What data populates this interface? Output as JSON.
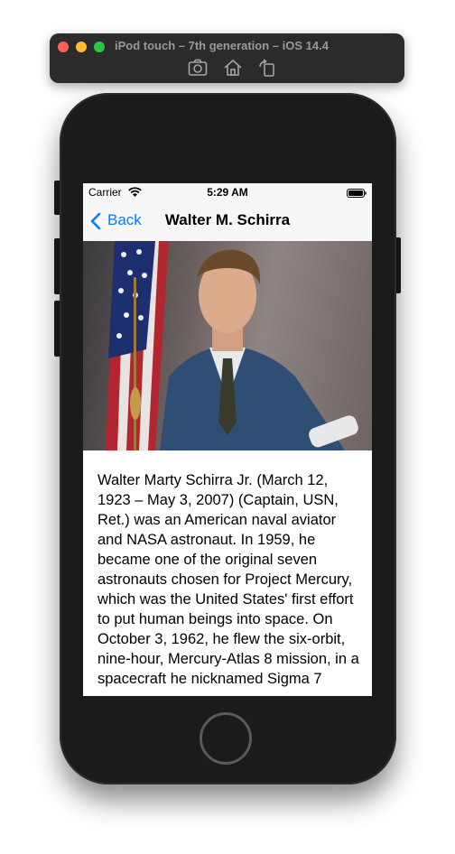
{
  "simulator": {
    "title": "iPod touch – 7th generation – iOS 14.4",
    "toolbar_icons": [
      "screenshot-icon",
      "home-icon",
      "rotate-icon"
    ]
  },
  "status_bar": {
    "carrier": "Carrier",
    "time": "5:29 AM"
  },
  "nav": {
    "back_label": "Back",
    "title": "Walter M. Schirra"
  },
  "detail": {
    "image_description_icon": "astronaut-portrait",
    "bio": "Walter Marty Schirra Jr. (March 12, 1923 – May 3, 2007) (Captain, USN, Ret.) was an American naval aviator and NASA astronaut. In 1959, he became one of the original seven astronauts chosen for Project Mercury, which was the United States' first effort to put human beings into space. On October 3, 1962, he flew the six-orbit, nine-hour, Mercury-Atlas 8 mission, in a spacecraft he nicknamed Sigma 7"
  },
  "colors": {
    "accent": "#0a7aff",
    "device": "#1b1b1b",
    "toolbar": "#2b2b2b"
  }
}
